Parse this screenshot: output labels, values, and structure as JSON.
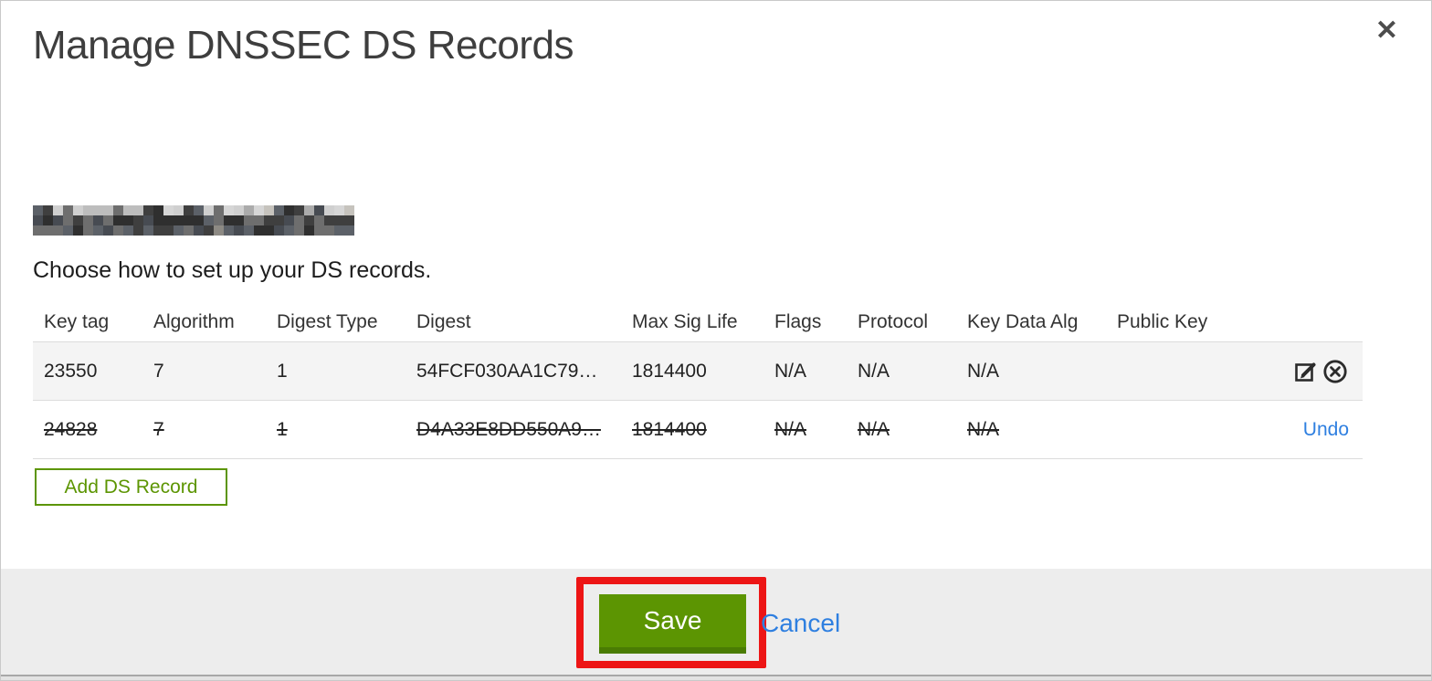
{
  "modal": {
    "title": "Manage DNSSEC DS Records",
    "instruction": "Choose how to set up your DS records.",
    "domain_redacted": true
  },
  "icons": {
    "close_glyph": "✕"
  },
  "table": {
    "columns": [
      "Key tag",
      "Algorithm",
      "Digest Type",
      "Digest",
      "Max Sig Life",
      "Flags",
      "Protocol",
      "Key Data Alg",
      "Public Key"
    ],
    "rows": [
      {
        "key_tag": "23550",
        "algorithm": "7",
        "digest_type": "1",
        "digest": "54FCF030AA1C79…",
        "max_sig_life": "1814400",
        "flags": "N/A",
        "protocol": "N/A",
        "key_data_alg": "N/A",
        "public_key": "",
        "state": "active"
      },
      {
        "key_tag": "24828",
        "algorithm": "7",
        "digest_type": "1",
        "digest": "D4A33E8DD550A9…",
        "max_sig_life": "1814400",
        "flags": "N/A",
        "protocol": "N/A",
        "key_data_alg": "N/A",
        "public_key": "",
        "state": "pending-delete",
        "action_label": "Undo"
      }
    ]
  },
  "buttons": {
    "add_ds_record": "Add DS Record",
    "save": "Save",
    "cancel": "Cancel"
  },
  "colors": {
    "accent_green": "#5c9502",
    "accent_green_dark": "#4a7c03",
    "link_blue": "#2e7fe0",
    "annotation_red": "#ed1515",
    "footer_bg": "#ededed",
    "row_stripe_bg": "#f4f4f4"
  }
}
